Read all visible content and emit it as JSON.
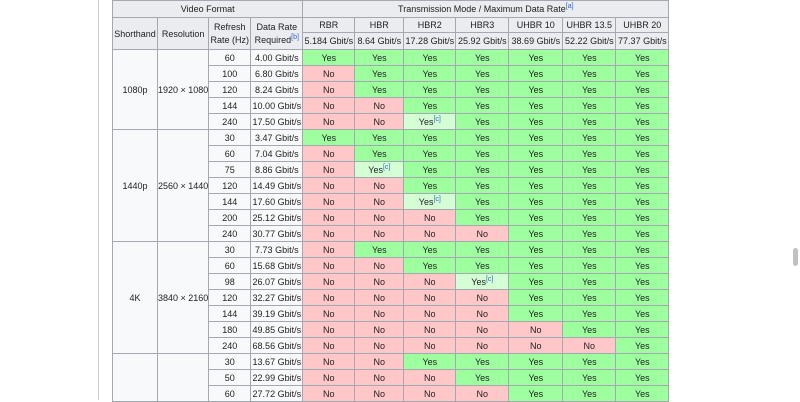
{
  "header": {
    "video_format": "Video Format",
    "shorthand": "Shorthand",
    "resolution": "Resolution",
    "refresh_rate": "Refresh Rate (Hz)",
    "data_rate": "Data Rate Required",
    "data_rate_note": "[b]",
    "transmission": "Transmission Mode / Maximum Data Rate",
    "transmission_note": "[a]",
    "modes": [
      "RBR",
      "HBR",
      "HBR2",
      "HBR3",
      "UHBR 10",
      "UHBR 13.5",
      "UHBR 20"
    ],
    "rates": [
      "5.184 Gbit/s",
      "8.64 Gbit/s",
      "17.28 Gbit/s",
      "25.92 Gbit/s",
      "38.69 Gbit/s",
      "52.22 Gbit/s",
      "77.37 Gbit/s"
    ]
  },
  "footnote_c": "[c]",
  "groups": [
    {
      "shorthand": "1080p",
      "resolution": "1920 × 1080",
      "rows": [
        {
          "hz": "60",
          "rate": "4.00 Gbit/s",
          "cells": [
            "Yes",
            "Yes",
            "Yes",
            "Yes",
            "Yes",
            "Yes",
            "Yes"
          ]
        },
        {
          "hz": "100",
          "rate": "6.80 Gbit/s",
          "cells": [
            "No",
            "Yes",
            "Yes",
            "Yes",
            "Yes",
            "Yes",
            "Yes"
          ]
        },
        {
          "hz": "120",
          "rate": "8.24 Gbit/s",
          "cells": [
            "No",
            "Yes",
            "Yes",
            "Yes",
            "Yes",
            "Yes",
            "Yes"
          ]
        },
        {
          "hz": "144",
          "rate": "10.00 Gbit/s",
          "cells": [
            "No",
            "No",
            "Yes",
            "Yes",
            "Yes",
            "Yes",
            "Yes"
          ]
        },
        {
          "hz": "240",
          "rate": "17.50 Gbit/s",
          "cells": [
            "No",
            "No",
            "Yes[c]",
            "Yes",
            "Yes",
            "Yes",
            "Yes"
          ]
        }
      ]
    },
    {
      "shorthand": "1440p",
      "resolution": "2560 × 1440",
      "rows": [
        {
          "hz": "30",
          "rate": "3.47 Gbit/s",
          "cells": [
            "Yes",
            "Yes",
            "Yes",
            "Yes",
            "Yes",
            "Yes",
            "Yes"
          ]
        },
        {
          "hz": "60",
          "rate": "7.04 Gbit/s",
          "cells": [
            "No",
            "Yes",
            "Yes",
            "Yes",
            "Yes",
            "Yes",
            "Yes"
          ]
        },
        {
          "hz": "75",
          "rate": "8.86 Gbit/s",
          "cells": [
            "No",
            "Yes[c]",
            "Yes",
            "Yes",
            "Yes",
            "Yes",
            "Yes"
          ]
        },
        {
          "hz": "120",
          "rate": "14.49 Gbit/s",
          "cells": [
            "No",
            "No",
            "Yes",
            "Yes",
            "Yes",
            "Yes",
            "Yes"
          ]
        },
        {
          "hz": "144",
          "rate": "17.60 Gbit/s",
          "cells": [
            "No",
            "No",
            "Yes[c]",
            "Yes",
            "Yes",
            "Yes",
            "Yes"
          ]
        },
        {
          "hz": "200",
          "rate": "25.12 Gbit/s",
          "cells": [
            "No",
            "No",
            "No",
            "Yes",
            "Yes",
            "Yes",
            "Yes"
          ]
        },
        {
          "hz": "240",
          "rate": "30.77 Gbit/s",
          "cells": [
            "No",
            "No",
            "No",
            "No",
            "Yes",
            "Yes",
            "Yes"
          ]
        }
      ]
    },
    {
      "shorthand": "4K",
      "resolution": "3840 × 2160",
      "rows": [
        {
          "hz": "30",
          "rate": "7.73 Gbit/s",
          "cells": [
            "No",
            "Yes",
            "Yes",
            "Yes",
            "Yes",
            "Yes",
            "Yes"
          ]
        },
        {
          "hz": "60",
          "rate": "15.68 Gbit/s",
          "cells": [
            "No",
            "No",
            "Yes",
            "Yes",
            "Yes",
            "Yes",
            "Yes"
          ]
        },
        {
          "hz": "98",
          "rate": "26.07 Gbit/s",
          "cells": [
            "No",
            "No",
            "No",
            "Yes[c]",
            "Yes",
            "Yes",
            "Yes"
          ]
        },
        {
          "hz": "120",
          "rate": "32.27 Gbit/s",
          "cells": [
            "No",
            "No",
            "No",
            "No",
            "Yes",
            "Yes",
            "Yes"
          ]
        },
        {
          "hz": "144",
          "rate": "39.19 Gbit/s",
          "cells": [
            "No",
            "No",
            "No",
            "No",
            "Yes",
            "Yes",
            "Yes"
          ]
        },
        {
          "hz": "180",
          "rate": "49.85 Gbit/s",
          "cells": [
            "No",
            "No",
            "No",
            "No",
            "No",
            "Yes",
            "Yes"
          ]
        },
        {
          "hz": "240",
          "rate": "68.56 Gbit/s",
          "cells": [
            "No",
            "No",
            "No",
            "No",
            "No",
            "No",
            "Yes"
          ]
        }
      ]
    },
    {
      "shorthand": "",
      "resolution": "",
      "rows": [
        {
          "hz": "30",
          "rate": "13.67 Gbit/s",
          "cells": [
            "No",
            "No",
            "Yes",
            "Yes",
            "Yes",
            "Yes",
            "Yes"
          ]
        },
        {
          "hz": "50",
          "rate": "22.99 Gbit/s",
          "cells": [
            "No",
            "No",
            "No",
            "Yes",
            "Yes",
            "Yes",
            "Yes"
          ]
        },
        {
          "hz": "60",
          "rate": "27.72 Gbit/s",
          "cells": [
            "No",
            "No",
            "No",
            "No",
            "Yes",
            "Yes",
            "Yes"
          ]
        }
      ]
    }
  ],
  "colors": {
    "yes": "#9eff9e",
    "no": "#ffc7c7",
    "partial": "#d4ffd4",
    "header_bg": "#eaecf0",
    "border": "#a2a9b1"
  }
}
